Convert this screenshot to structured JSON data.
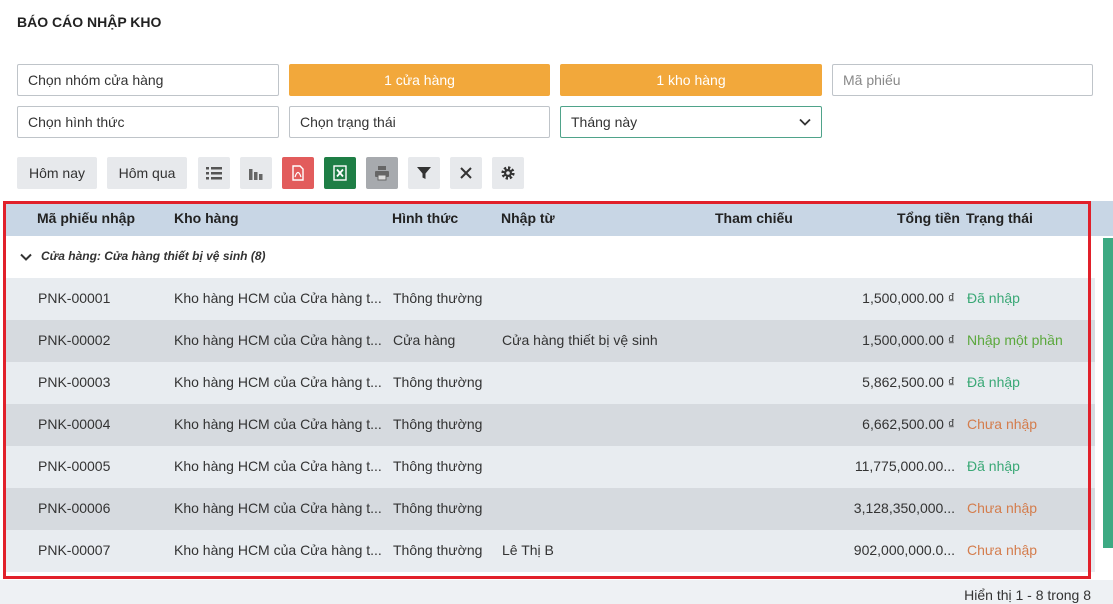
{
  "header": {
    "title": "BÁO CÁO NHẬP KHO"
  },
  "filters": {
    "store_group": "Chọn nhóm cửa hàng",
    "store": "1 cửa hàng",
    "warehouse": "1 kho hàng",
    "voucher_placeholder": "Mã phiếu",
    "form_type": "Chọn hình thức",
    "status": "Chọn trạng thái",
    "period": "Tháng này"
  },
  "toolbar": {
    "today_label": "Hôm nay",
    "yesterday_label": "Hôm qua",
    "icons": [
      "list-icon",
      "chart-icon",
      "pdf-icon",
      "excel-icon",
      "print-icon",
      "filter-icon",
      "clear-icon",
      "settings-icon"
    ],
    "colors": {
      "pdf": "#e25c5c",
      "excel": "#1e7e45",
      "print": "#a7aaae",
      "accent_orange": "#f2a83b"
    }
  },
  "table": {
    "columns": [
      "Mã phiếu nhập",
      "Kho hàng",
      "Hình thức",
      "Nhập từ",
      "Tham chiếu",
      "Tổng tiền",
      "Trạng thái"
    ],
    "group_label": "Cửa hàng: Cửa hàng thiết bị vệ sinh (8)",
    "rows": [
      {
        "code": "PNK-00001",
        "warehouse": "Kho hàng HCM của Cửa hàng t...",
        "form": "Thông thường",
        "from": "",
        "ref": "",
        "total": "1,500,000.00 ₫",
        "status": "Đã nhập"
      },
      {
        "code": "PNK-00002",
        "warehouse": "Kho hàng HCM của Cửa hàng t...",
        "form": "Cửa hàng",
        "from": "Cửa hàng thiết bị vệ sinh",
        "ref": "",
        "total": "1,500,000.00 ₫",
        "status": "Nhập một phần"
      },
      {
        "code": "PNK-00003",
        "warehouse": "Kho hàng HCM của Cửa hàng t...",
        "form": "Thông thường",
        "from": "",
        "ref": "",
        "total": "5,862,500.00 ₫",
        "status": "Đã nhập"
      },
      {
        "code": "PNK-00004",
        "warehouse": "Kho hàng HCM của Cửa hàng t...",
        "form": "Thông thường",
        "from": "",
        "ref": "",
        "total": "6,662,500.00 ₫",
        "status": "Chưa nhập"
      },
      {
        "code": "PNK-00005",
        "warehouse": "Kho hàng HCM của Cửa hàng t...",
        "form": "Thông thường",
        "from": "",
        "ref": "",
        "total": "11,775,000.00...",
        "status": "Đã nhập"
      },
      {
        "code": "PNK-00006",
        "warehouse": "Kho hàng HCM của Cửa hàng t...",
        "form": "Thông thường",
        "from": "",
        "ref": "",
        "total": "3,128,350,000...",
        "status": "Chưa nhập"
      },
      {
        "code": "PNK-00007",
        "warehouse": "Kho hàng HCM của Cửa hàng t...",
        "form": "Thông thường",
        "from": "Lê Thị B",
        "ref": "",
        "total": "902,000,000.0...",
        "status": "Chưa nhập"
      }
    ]
  },
  "footer": {
    "pagination": "Hiển thị 1 - 8 trong 8"
  }
}
